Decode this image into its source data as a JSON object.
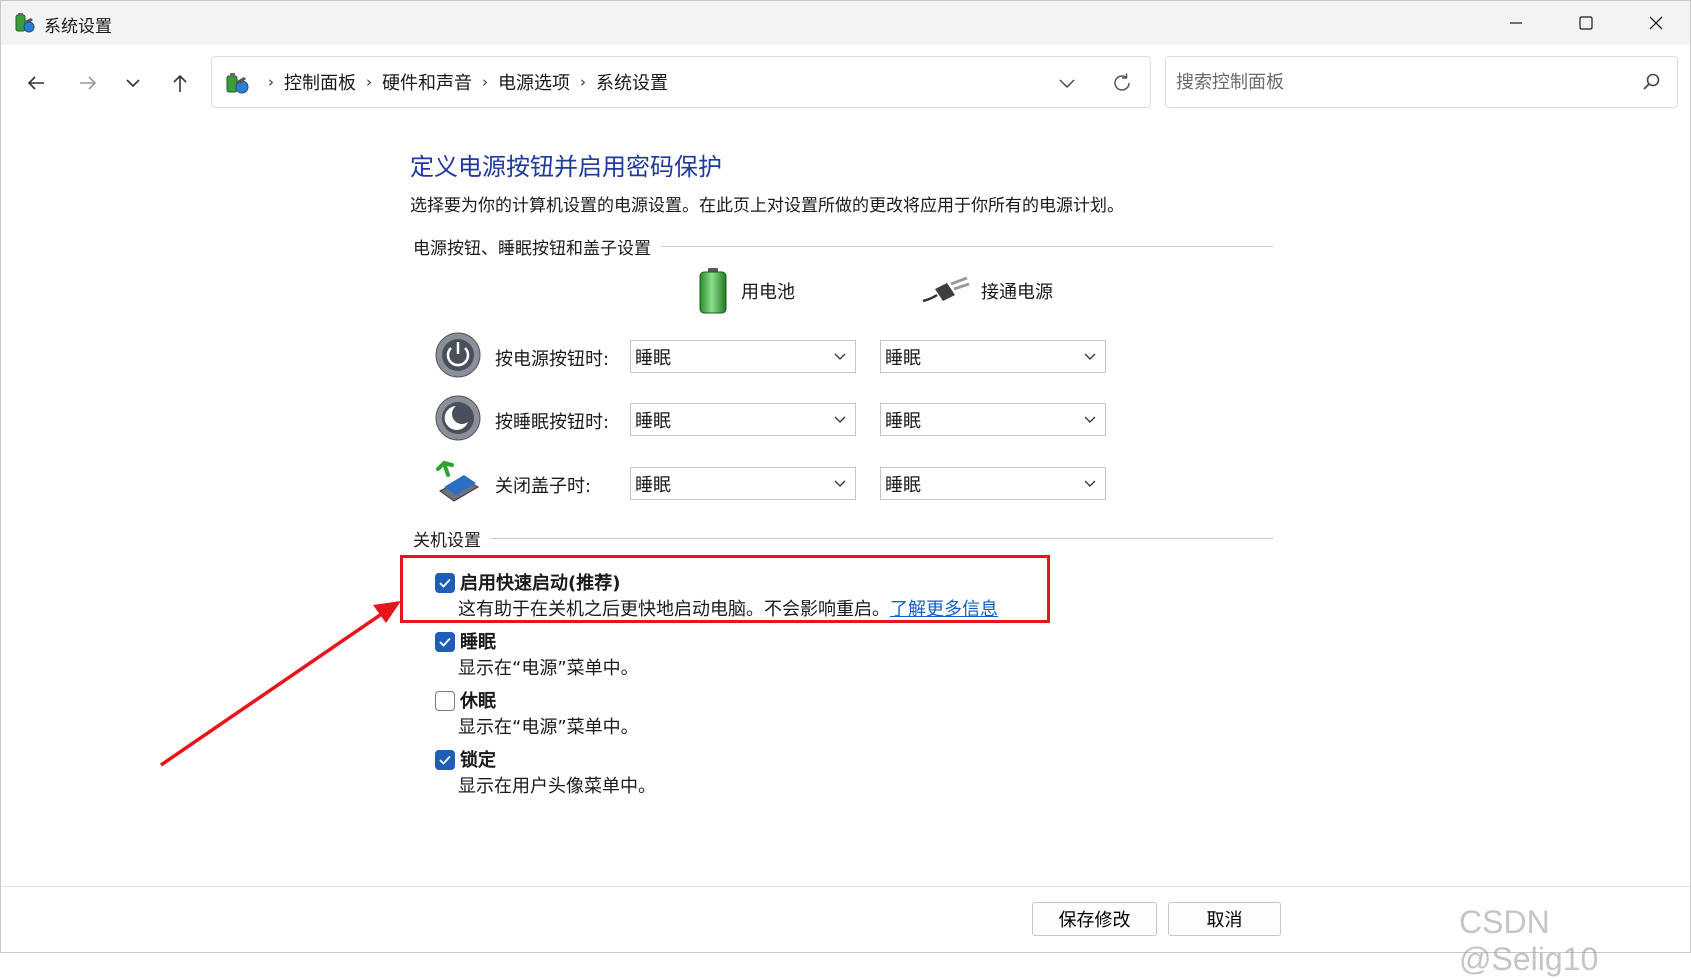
{
  "window": {
    "title": "系统设置"
  },
  "nav": {
    "breadcrumbs": [
      "控制面板",
      "硬件和声音",
      "电源选项",
      "系统设置"
    ],
    "search_placeholder": "搜索控制面板"
  },
  "page": {
    "title": "定义电源按钮并启用密码保护",
    "description": "选择要为你的计算机设置的电源设置。在此页上对设置所做的更改将应用于你所有的电源计划。"
  },
  "power_section": {
    "heading": "电源按钮、睡眠按钮和盖子设置",
    "col_battery": "用电池",
    "col_plugged": "接通电源",
    "rows": [
      {
        "label": "按电源按钮时:",
        "battery": "睡眠",
        "plugged": "睡眠"
      },
      {
        "label": "按睡眠按钮时:",
        "battery": "睡眠",
        "plugged": "睡眠"
      },
      {
        "label": "关闭盖子时:",
        "battery": "睡眠",
        "plugged": "睡眠"
      }
    ]
  },
  "shutdown_section": {
    "heading": "关机设置",
    "options": [
      {
        "title": "启用快速启动(推荐)",
        "desc": "这有助于在关机之后更快地启动电脑。不会影响重启。",
        "link": "了解更多信息",
        "checked": true
      },
      {
        "title": "睡眠",
        "desc": "显示在“电源”菜单中。",
        "checked": true
      },
      {
        "title": "休眠",
        "desc": "显示在“电源”菜单中。",
        "checked": false
      },
      {
        "title": "锁定",
        "desc": "显示在用户头像菜单中。",
        "checked": true
      }
    ]
  },
  "footer": {
    "save_label": "保存修改",
    "cancel_label": "取消"
  },
  "watermark": "CSDN @Selig10",
  "colors": {
    "accent": "#1f5db8",
    "title_blue": "#1e3a9c",
    "annotation_red": "#e8141b",
    "link": "#1060c8"
  }
}
